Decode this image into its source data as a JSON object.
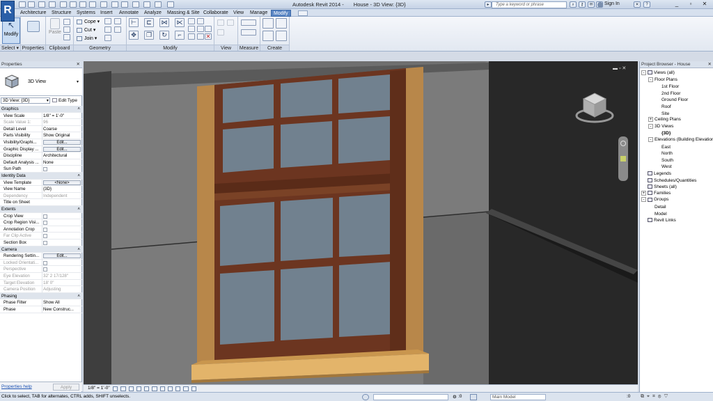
{
  "app": {
    "logo": "R",
    "title_product": "Autodesk Revit 2014 -",
    "title_file": "House - 3D View: {3D}",
    "search_placeholder": "Type a keyword or phrase",
    "signin": "Sign In"
  },
  "tabs": [
    "Architecture",
    "Structure",
    "Systems",
    "Insert",
    "Annotate",
    "Analyze",
    "Massing & Site",
    "Collaborate",
    "View",
    "Manage",
    "Modify"
  ],
  "active_tab": "Modify",
  "ribbon": {
    "select_label": "Select",
    "modify_label": "Modify",
    "properties_label": "Properties",
    "clipboard_label": "Clipboard",
    "paste_label": "Paste",
    "geometry_label": "Geometry",
    "cope_label": "Cope",
    "cut_label": "Cut",
    "join_label": "Join",
    "modify_panel_label": "Modify",
    "view_label": "View",
    "measure_label": "Measure",
    "create_label": "Create"
  },
  "properties": {
    "header": "Properties",
    "type_name": "3D View",
    "instance_selector": "3D View: {3D}",
    "edit_type": "Edit Type",
    "help_link": "Properties help",
    "apply": "Apply",
    "rows": [
      {
        "group": "Graphics"
      },
      {
        "k": "View Scale",
        "v": "1/8\" = 1'-0\""
      },
      {
        "k": "Scale Value  1:",
        "v": "96",
        "gray": true
      },
      {
        "k": "Detail Level",
        "v": "Coarse"
      },
      {
        "k": "Parts Visibility",
        "v": "Show Original"
      },
      {
        "k": "Visibility/Graphi...",
        "btn": "Edit..."
      },
      {
        "k": "Graphic Display ...",
        "btn": "Edit..."
      },
      {
        "k": "Discipline",
        "v": "Architectural"
      },
      {
        "k": "Default Analysis ...",
        "v": "None"
      },
      {
        "k": "Sun Path",
        "cb": true
      },
      {
        "group": "Identity Data"
      },
      {
        "k": "View Template",
        "btn": "<None>"
      },
      {
        "k": "View Name",
        "v": "{3D}"
      },
      {
        "k": "Dependency",
        "v": "Independent",
        "gray": true
      },
      {
        "k": "Title on Sheet",
        "v": ""
      },
      {
        "group": "Extents"
      },
      {
        "k": "Crop View",
        "cb": true
      },
      {
        "k": "Crop Region Visi...",
        "cb": true
      },
      {
        "k": "Annotation Crop",
        "cb": true
      },
      {
        "k": "Far Clip Active",
        "cb": true,
        "gray": true
      },
      {
        "k": "Section Box",
        "cb": true
      },
      {
        "group": "Camera"
      },
      {
        "k": "Rendering Settin...",
        "btn": "Edit..."
      },
      {
        "k": "Locked Orientati...",
        "cb": true,
        "gray": true
      },
      {
        "k": "Perspective",
        "cb": true,
        "gray": true
      },
      {
        "k": "Eye Elevation",
        "v": "32' 2 17/128\"",
        "gray": true
      },
      {
        "k": "Target Elevation",
        "v": "18' 0\"",
        "gray": true
      },
      {
        "k": "Camera Position",
        "v": "Adjusting",
        "gray": true
      },
      {
        "group": "Phasing"
      },
      {
        "k": "Phase Filter",
        "v": "Show All"
      },
      {
        "k": "Phase",
        "v": "New Construc..."
      }
    ]
  },
  "browser": {
    "header": "Project Browser - House",
    "items": [
      {
        "label": "Views (all)",
        "level": 0,
        "exp": "-"
      },
      {
        "label": "Floor Plans",
        "level": 1,
        "exp": "-"
      },
      {
        "label": "1st Floor",
        "level": 2
      },
      {
        "label": "2nd Floor",
        "level": 2
      },
      {
        "label": "Ground Floor",
        "level": 2
      },
      {
        "label": "Roof",
        "level": 2
      },
      {
        "label": "Site",
        "level": 2
      },
      {
        "label": "Ceiling Plans",
        "level": 1,
        "exp": "+"
      },
      {
        "label": "3D Views",
        "level": 1,
        "exp": "-"
      },
      {
        "label": "{3D}",
        "level": 2,
        "bold": true
      },
      {
        "label": "Elevations (Building Elevation)",
        "level": 1,
        "exp": "-"
      },
      {
        "label": "East",
        "level": 2
      },
      {
        "label": "North",
        "level": 2
      },
      {
        "label": "South",
        "level": 2
      },
      {
        "label": "West",
        "level": 2
      },
      {
        "label": "Legends",
        "level": 0
      },
      {
        "label": "Schedules/Quantities",
        "level": 0
      },
      {
        "label": "Sheets (all)",
        "level": 0
      },
      {
        "label": "Families",
        "level": 0,
        "exp": "+"
      },
      {
        "label": "Groups",
        "level": 0,
        "exp": "-"
      },
      {
        "label": "Detail",
        "level": 1
      },
      {
        "label": "Model",
        "level": 1
      },
      {
        "label": "Revit Links",
        "level": 0
      }
    ]
  },
  "viewport": {
    "scale": "1/8\" = 1'-0\""
  },
  "status": {
    "text": "Click to select, TAB for alternates, CTRL adds, SHIFT unselects.",
    "zero1": ":0",
    "model": "Main Model",
    "zero2": ":0"
  }
}
